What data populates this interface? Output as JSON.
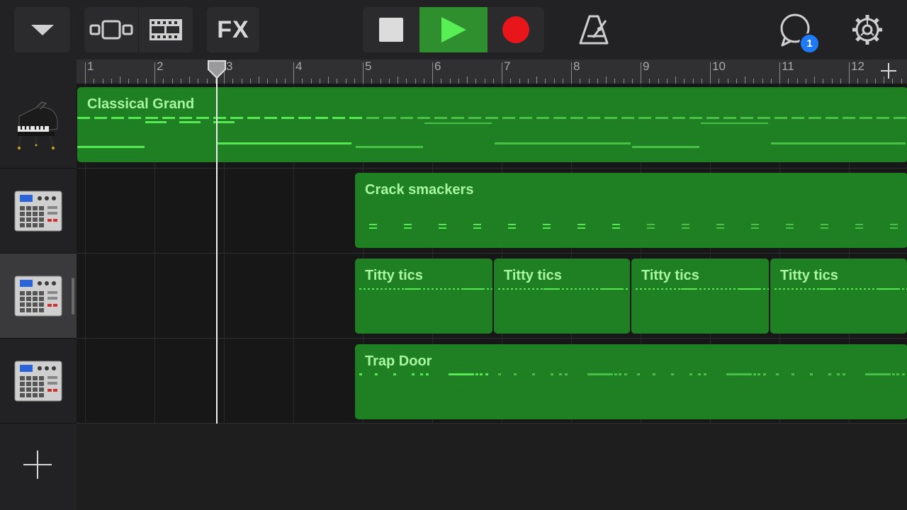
{
  "toolbar": {
    "fx_label": "FX",
    "notification_count": "1",
    "icons": {
      "browser": "chevron-down-icon",
      "views": "tracks-view-icon",
      "loops": "loop-browser-icon",
      "stop": "stop-icon",
      "play": "play-icon",
      "record": "record-icon",
      "metronome": "metronome-icon",
      "notifications": "live-loops-icon",
      "settings": "gear-icon"
    },
    "colors": {
      "play_active": "#2f8f2f",
      "record": "#e8151b"
    }
  },
  "ruler": {
    "bars": [
      "1",
      "2",
      "3",
      "4",
      "5",
      "6",
      "7",
      "8",
      "9",
      "10",
      "11",
      "12"
    ]
  },
  "tracks": [
    {
      "instrument_icon": "grand-piano-icon",
      "selected": false,
      "regions": [
        {
          "name": "Classical Grand"
        }
      ]
    },
    {
      "instrument_icon": "drum-machine-icon",
      "selected": false,
      "regions": [
        {
          "name": "Crack smackers"
        }
      ]
    },
    {
      "instrument_icon": "drum-machine-icon",
      "selected": true,
      "regions": [
        {
          "name": "Titty tics"
        },
        {
          "name": "Titty tics"
        },
        {
          "name": "Titty tics"
        },
        {
          "name": "Titty tics"
        }
      ]
    },
    {
      "instrument_icon": "drum-machine-icon",
      "selected": false,
      "regions": [
        {
          "name": "Trap Door"
        }
      ]
    }
  ],
  "colors": {
    "region_green": "#1f7f23",
    "note_green": "#58e854",
    "region_label": "#a8f7a0"
  }
}
